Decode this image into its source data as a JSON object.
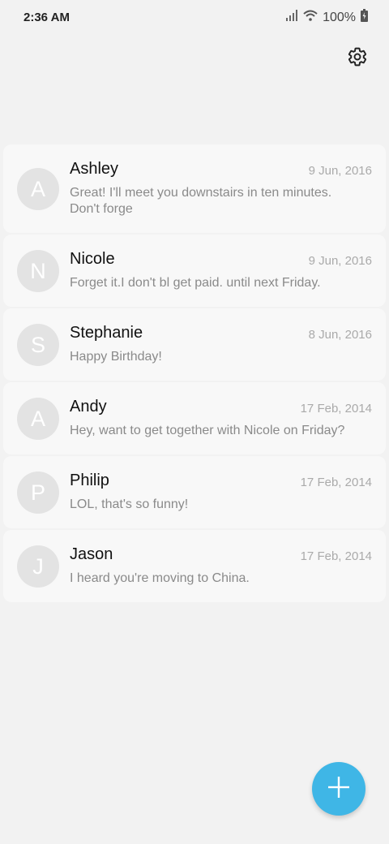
{
  "status_bar": {
    "time": "2:36 AM",
    "battery": "100%",
    "icons": [
      "signal-icon",
      "wifi-icon",
      "battery-icon"
    ]
  },
  "toolbar": {
    "settings_icon": "gear-icon"
  },
  "conversations": [
    {
      "initial": "A",
      "name": "Ashley",
      "date": "9 Jun, 2016",
      "preview": "Great! I'll meet you downstairs in ten minutes. Don't forge"
    },
    {
      "initial": "N",
      "name": "Nicole",
      "date": "9 Jun, 2016",
      "preview": "Forget it.I don't bl get paid. until next Friday."
    },
    {
      "initial": "S",
      "name": "Stephanie",
      "date": "8 Jun, 2016",
      "preview": "Happy Birthday!"
    },
    {
      "initial": "A",
      "name": "Andy",
      "date": "17 Feb, 2014",
      "preview": "Hey, want to get together with Nicole on Friday?"
    },
    {
      "initial": "P",
      "name": "Philip",
      "date": "17 Feb, 2014",
      "preview": "LOL, that's so funny!"
    },
    {
      "initial": "J",
      "name": "Jason",
      "date": "17 Feb, 2014",
      "preview": "I heard you're moving to China."
    }
  ],
  "fab": {
    "icon": "plus-icon"
  },
  "colors": {
    "background": "#f2f2f2",
    "card": "#f8f8f8",
    "avatar": "#e3e3e3",
    "accent": "#3fb6e6",
    "date_text": "#aaaaaa",
    "preview_text": "#8a8a8a"
  }
}
